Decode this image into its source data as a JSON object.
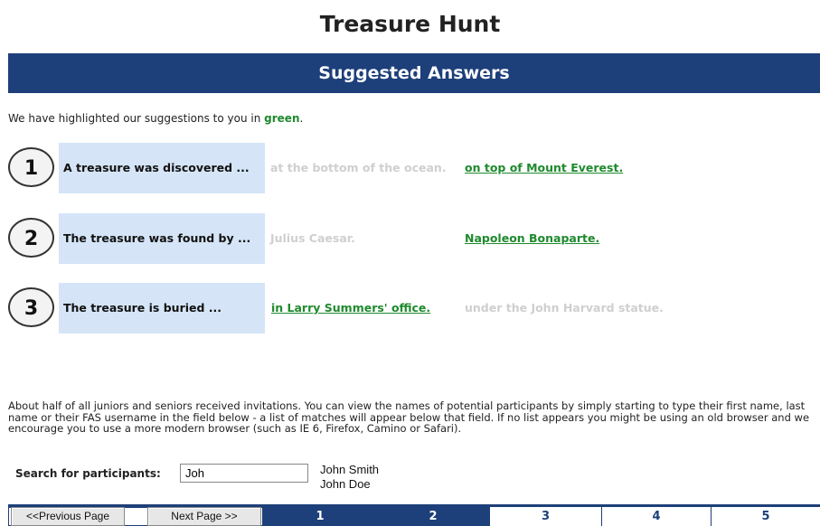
{
  "title": "Treasure Hunt",
  "banner": "Suggested Answers",
  "intro": {
    "prefix": "We have highlighted our suggestions to you in ",
    "highlight": "green",
    "suffix": "."
  },
  "questions": [
    {
      "number": "1",
      "prompt": "A treasure was discovered ...",
      "answers": [
        "at the bottom of the ocean.",
        "on top of Mount Everest."
      ],
      "selected": 1
    },
    {
      "number": "2",
      "prompt": "The treasure was found by ...",
      "answers": [
        "Julius Caesar.",
        "Napoleon Bonaparte."
      ],
      "selected": 1
    },
    {
      "number": "3",
      "prompt": "The treasure is buried ...",
      "answers": [
        "in Larry Summers' office.",
        "under the John Harvard statue."
      ],
      "selected": 0
    }
  ],
  "about": "About half of all juniors and seniors received invitations. You can view the names of potential participants by simply starting to type their first name, last name or their FAS username in the field below - a list of matches will appear below that field. If no list appears you might be using an old browser and we encourage you to use a more modern browser (such as IE 6, Firefox, Camino or Safari).",
  "search": {
    "label": "Search for participants:",
    "value": "Joh",
    "suggestions": [
      "John Smith",
      "John Doe"
    ]
  },
  "pager": {
    "prev": "<<Previous Page",
    "next": "Next Page >>",
    "pages": [
      "1",
      "2",
      "3",
      "4",
      "5"
    ],
    "current_page": "2"
  },
  "colors": {
    "brand": "#1d3f7a",
    "highlight": "#1f8a2e",
    "question_bg": "#d5e5f7",
    "dimmed": "#cfcfcf"
  }
}
